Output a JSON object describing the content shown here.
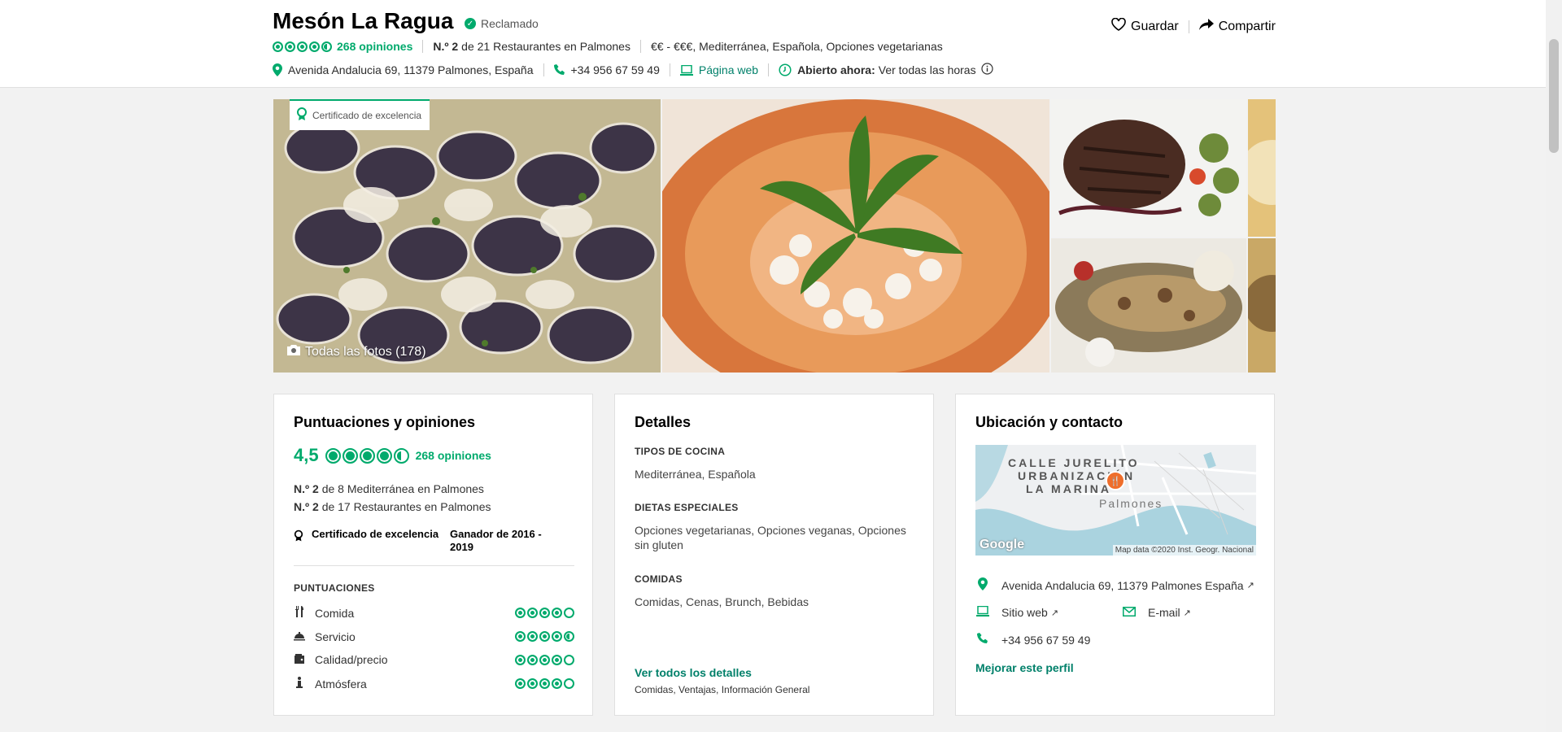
{
  "header": {
    "title": "Mesón La Ragua",
    "claimed": "Reclamado",
    "rating_bubbles": 4.5,
    "reviews": "268 opiniones",
    "rank_number": "N.º 2",
    "rank_rest": "de 21 Restaurantes en Palmones",
    "price_cuisine": "€€ - €€€, Mediterránea, Española, Opciones vegetarianas",
    "address": "Avenida Andalucia 69, 11379 Palmones, España",
    "phone": "+34 956 67 59 49",
    "website": "Página web",
    "open_label": "Abierto ahora:",
    "open_hours": "Ver todas las horas",
    "save": "Guardar",
    "share": "Compartir"
  },
  "photos": {
    "certificate": "Certificado de excelencia",
    "all_photos": "Todas las fotos (178)"
  },
  "ratings_card": {
    "title": "Puntuaciones y opiniones",
    "score": "4,5",
    "reviews": "268 opiniones",
    "rank1_num": "N.º 2",
    "rank1_rest": "de 8 Mediterránea en Palmones",
    "rank2_num": "N.º 2",
    "rank2_rest": "de 17 Restaurantes en Palmones",
    "cert_label": "Certificado de excelencia",
    "cert_winner": "Ganador de 2016 - 2019",
    "scores_heading": "PUNTUACIONES",
    "scores": [
      {
        "label": "Comida",
        "rating": 4
      },
      {
        "label": "Servicio",
        "rating": 4.5
      },
      {
        "label": "Calidad/precio",
        "rating": 4
      },
      {
        "label": "Atmósfera",
        "rating": 4
      }
    ]
  },
  "details_card": {
    "title": "Detalles",
    "cuisine_heading": "TIPOS DE COCINA",
    "cuisine": "Mediterránea, Española",
    "diets_heading": "DIETAS ESPECIALES",
    "diets": "Opciones vegetarianas, Opciones veganas, Opciones sin gluten",
    "meals_heading": "COMIDAS",
    "meals": "Comidas, Cenas, Brunch, Bebidas",
    "all_details": "Ver todos los detalles",
    "all_details_sub": "Comidas, Ventajas, Información General"
  },
  "location_card": {
    "title": "Ubicación y contacto",
    "map_street1": "CALLE JURELITO",
    "map_street2": "URBANIZACIÓN",
    "map_street3": "LA MARINA",
    "map_town": "Palmones",
    "map_google": "Google",
    "map_attrib": "Map data ©2020 Inst. Geogr. Nacional",
    "address": "Avenida Andalucia 69, 11379 Palmones España",
    "website": "Sitio web",
    "email": "E-mail",
    "phone": "+34 956 67 59 49",
    "improve": "Mejorar este perfil"
  }
}
